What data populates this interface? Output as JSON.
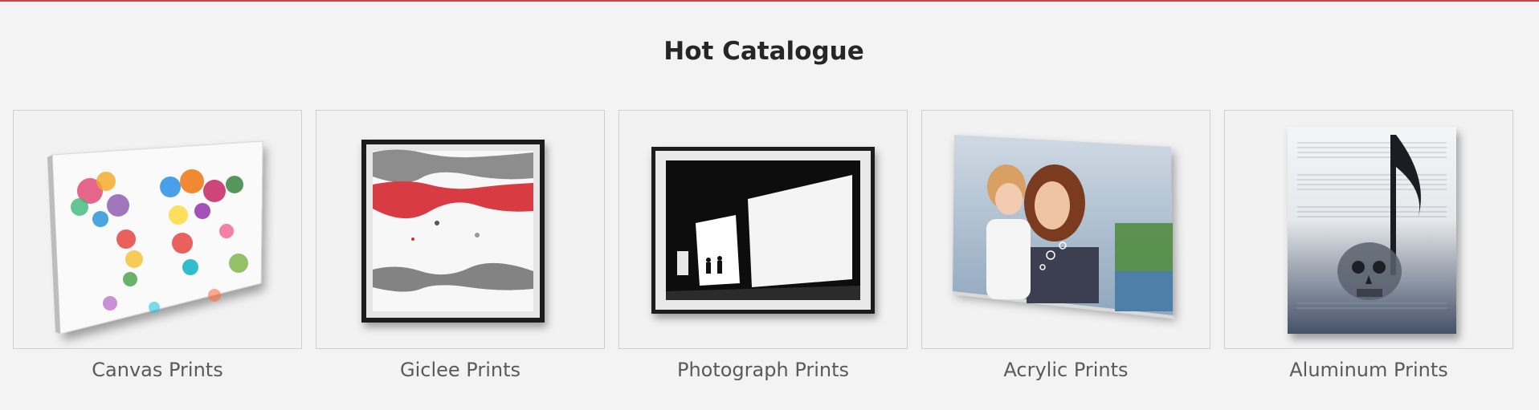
{
  "section": {
    "title": "Hot Catalogue"
  },
  "catalogue": {
    "items": [
      {
        "label": "Canvas Prints"
      },
      {
        "label": "Giclee Prints"
      },
      {
        "label": "Photograph Prints"
      },
      {
        "label": "Acrylic Prints"
      },
      {
        "label": "Aluminum Prints"
      }
    ]
  },
  "colors": {
    "accent_rule": "#c9484d",
    "background": "#f3f3f3",
    "caption_text": "#5a5a5a",
    "heading_text": "#262626"
  }
}
